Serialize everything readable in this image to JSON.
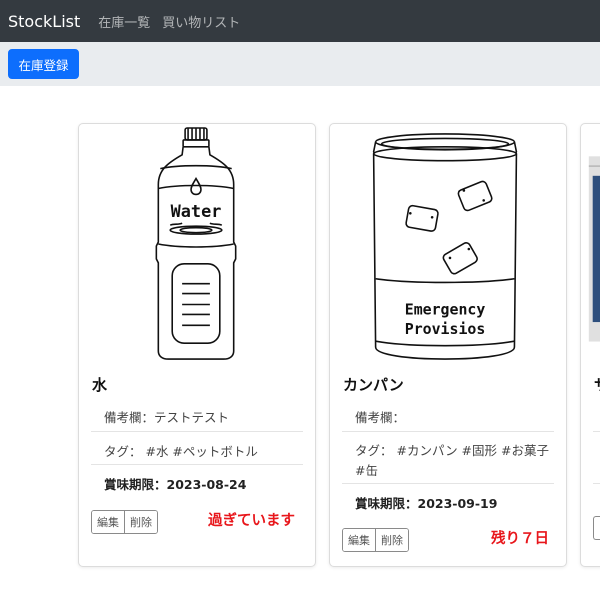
{
  "navbar": {
    "brand": "StockList",
    "links": [
      "在庫一覧",
      "買い物リスト"
    ]
  },
  "toolbar": {
    "register_label": "在庫登録"
  },
  "cards": [
    {
      "name": "水",
      "image_text": "Water",
      "note": "備考欄：テストテスト",
      "tags": "タグ： #水 #ペットボトル",
      "expiry": "賞味期限：2023-08-24",
      "status": "過ぎています",
      "edit_label": "編集",
      "delete_label": "削除"
    },
    {
      "name": "カンパン",
      "image_text_line1": "Emergency",
      "image_text_line2": "Provisios",
      "note": "備考欄：",
      "tags_line1": "タグ： #カンパン #固形 #お菓子",
      "tags_line2": "#缶",
      "expiry": "賞味期限：2023-09-19",
      "status": "残り７日",
      "edit_label": "編集",
      "delete_label": "削除"
    },
    {
      "name": "サ"
    }
  ],
  "colors": {
    "navbar": "#343a40",
    "subbar": "#e9ecef",
    "primary": "#0d6efd",
    "alert": "#e8161b"
  }
}
